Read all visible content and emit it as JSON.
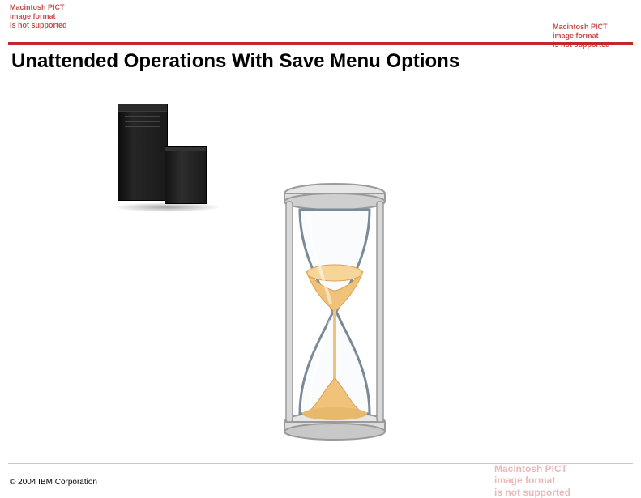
{
  "pict_notice": {
    "line1": "Macintosh PICT",
    "line2": "image format",
    "line3": "is not supported"
  },
  "title": "Unattended Operations With Save Menu Options",
  "copyright": "© 2004 IBM Corporation",
  "icons": {
    "server": "server-tower-icon",
    "hourglass": "hourglass-icon"
  },
  "colors": {
    "accent_rule": "#c1272d",
    "sand": "#f0c27a",
    "sand_dark": "#d9a24f",
    "glass_outline": "#7a8a99",
    "frame": "#d8d8d8"
  }
}
